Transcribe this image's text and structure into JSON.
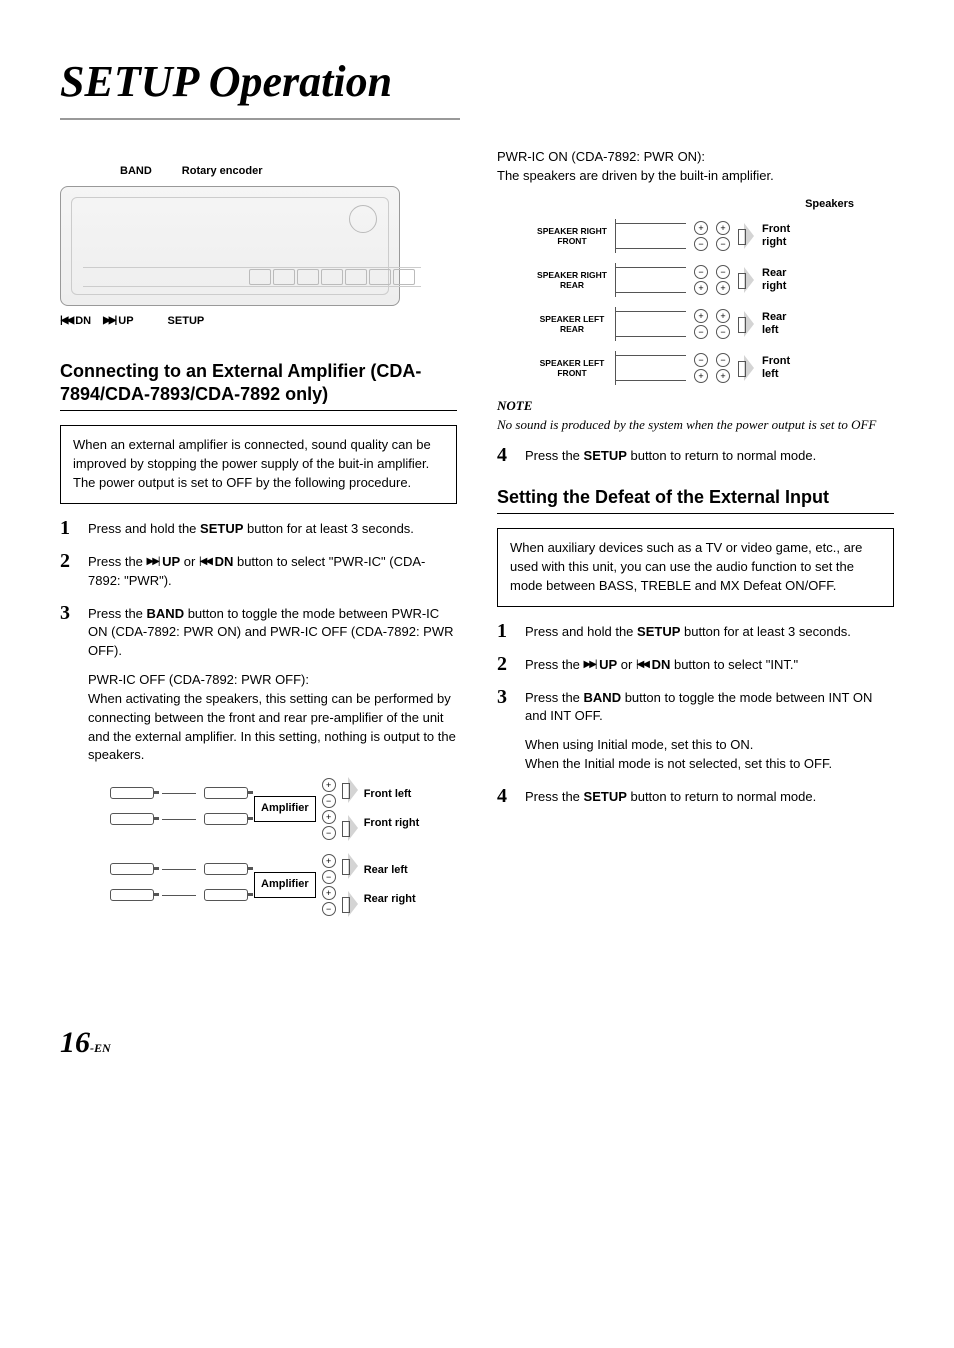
{
  "page_title": "SETUP Operation",
  "device": {
    "top_labels": {
      "band": "BAND",
      "rotary": "Rotary encoder"
    },
    "bottom_labels": {
      "dn": "DN",
      "up": "UP",
      "setup": "SETUP"
    }
  },
  "section1": {
    "heading": "Connecting to an External Amplifier (CDA-7894/CDA-7893/CDA-7892 only)",
    "intro": "When an external amplifier is connected, sound quality can be improved by stopping the power supply of the buit-in amplifier. The power output is set to OFF by the following procedure.",
    "steps": [
      {
        "n": "1",
        "t_pre": "Press and hold the ",
        "t_b": "SETUP",
        "t_post": " button for at least 3 seconds."
      },
      {
        "n": "2",
        "custom": "up_dn_pwric"
      },
      {
        "n": "3",
        "t_pre": "Press the ",
        "t_b": "BAND",
        "t_post": " button to toggle the mode between PWR-IC ON (CDA-7892: PWR ON) and PWR-IC OFF (CDA-7892: PWR OFF)."
      }
    ],
    "off_head": "PWR-IC OFF (CDA-7892: PWR OFF):",
    "off_body": "When activating the speakers, this setting can be performed by connecting between the front and rear pre-amplifier of the unit and the external amplifier. In this setting, nothing is output to the speakers.",
    "amp_labels": {
      "amplifier": "Amplifier",
      "fl": "Front left",
      "fr": "Front right",
      "rl": "Rear left",
      "rr": "Rear right"
    }
  },
  "right": {
    "on_head": "PWR-IC ON (CDA-7892: PWR ON):",
    "on_body": "The speakers are driven by the built-in amplifier.",
    "spk_head": "Speakers",
    "spk": [
      {
        "name": "SPEAKER RIGHT FRONT",
        "lbl": "Front right"
      },
      {
        "name": "SPEAKER RIGHT REAR",
        "lbl": "Rear right"
      },
      {
        "name": "SPEAKER LEFT REAR",
        "lbl": "Rear left"
      },
      {
        "name": "SPEAKER LEFT FRONT",
        "lbl": "Front left"
      }
    ],
    "note_head": "NOTE",
    "note_body": "No sound is produced by the system when the power output is set to OFF",
    "step4_pre": "Press the ",
    "step4_b": "SETUP",
    "step4_post": " button to return to normal mode.",
    "step4_n": "4"
  },
  "section2": {
    "heading": "Setting the Defeat of the External Input",
    "intro": "When auxiliary devices such as a TV or video game, etc., are used with this unit, you can use the audio function to set the mode between BASS, TREBLE and MX Defeat ON/OFF.",
    "steps": [
      {
        "n": "1",
        "t_pre": "Press and hold the ",
        "t_b": "SETUP",
        "t_post": " button for at least 3 seconds."
      },
      {
        "n": "2",
        "custom": "up_dn_int"
      },
      {
        "n": "3",
        "t_pre": "Press the ",
        "t_b": "BAND",
        "t_post": " button to toggle the mode between INT ON and INT OFF.",
        "sub": "When using Initial mode, set this to ON.\nWhen the Initial mode is not selected, set this to OFF."
      },
      {
        "n": "4",
        "t_pre": "Press the ",
        "t_b": "SETUP",
        "t_post": " button to return to normal mode."
      }
    ]
  },
  "glyphs": {
    "prev": "|◀◀",
    "next": "▶▶|",
    "plus": "+",
    "minus": "−",
    "up_label": " UP",
    "dn_label": " DN",
    "press_the": "Press the ",
    "or": " or ",
    "sel_pwric": " button to select \"PWR-IC\" (CDA-7892: \"PWR\").",
    "sel_int": " button to select \"INT.\""
  },
  "footer": {
    "page": "16",
    "suffix": "-EN"
  }
}
